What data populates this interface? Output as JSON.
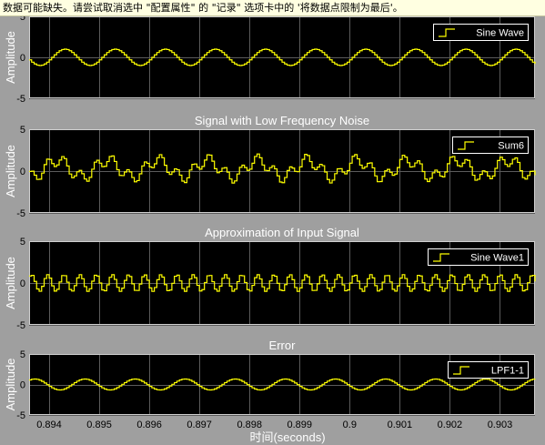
{
  "warning": {
    "text": "数据可能缺失。请尝试取消选中 \"配置属性\" 的 \"记录\" 选项卡中的 '将数据点限制为最后'。"
  },
  "colors": {
    "figure_bg": "#9f9f9f",
    "axes_bg": "#000000",
    "grid": "#5b5b5b",
    "signal": "#ffff00",
    "text": "#ffffff",
    "tick_text": "#000000",
    "warning_bg": "#ffffe1"
  },
  "chart_data": [
    {
      "type": "line",
      "title": "",
      "xlabel": "",
      "ylabel": "Amplitude",
      "xlim": [
        0.8936,
        0.9037
      ],
      "ylim": [
        -5,
        5
      ],
      "yticks": [
        -5,
        0,
        5
      ],
      "grid": true,
      "legend_position": "top-right",
      "series": [
        {
          "name": "Sine Wave",
          "signal": {
            "offset": 0,
            "components": [
              {
                "amplitude": 1.0,
                "frequency_hz": 1000,
                "phase_deg": -18
              }
            ]
          }
        }
      ]
    },
    {
      "type": "line",
      "title": "Signal with Low Frequency Noise",
      "xlabel": "",
      "ylabel": "Amplitude",
      "xlim": [
        0.8936,
        0.9037
      ],
      "ylim": [
        -5,
        5
      ],
      "yticks": [
        -5,
        0,
        5
      ],
      "grid": true,
      "legend_position": "top-right",
      "series": [
        {
          "name": "Sum6",
          "signal": {
            "offset": 0.3,
            "components": [
              {
                "amplitude": 1.0,
                "frequency_hz": 1000,
                "phase_deg": 40
              },
              {
                "amplitude": 0.75,
                "frequency_hz": 3100,
                "phase_deg": 0
              }
            ]
          }
        }
      ]
    },
    {
      "type": "line",
      "title": "Approximation of Input Signal",
      "xlabel": "",
      "ylabel": "Amplitude",
      "xlim": [
        0.8936,
        0.9037
      ],
      "ylim": [
        -5,
        5
      ],
      "yticks": [
        -5,
        0,
        5
      ],
      "grid": true,
      "legend_position": "top-right",
      "series": [
        {
          "name": "Sine Wave1",
          "signal": {
            "offset": 0,
            "components": [
              {
                "amplitude": 1.0,
                "frequency_hz": 3100,
                "phase_deg": 0
              }
            ]
          }
        }
      ]
    },
    {
      "type": "line",
      "title": "Error",
      "xlabel": "时间(seconds)",
      "ylabel": "Amplitude",
      "xlim": [
        0.8936,
        0.9037
      ],
      "ylim": [
        -5,
        5
      ],
      "yticks": [
        -5,
        0,
        5
      ],
      "xticks": [
        "0.894",
        "0.895",
        "0.896",
        "0.897",
        "0.898",
        "0.899",
        "0.9",
        "0.901",
        "0.902",
        "0.903"
      ],
      "grid": true,
      "legend_position": "top-right",
      "series": [
        {
          "name": "LPF1-1",
          "signal": {
            "offset": 0,
            "components": [
              {
                "amplitude": 0.9,
                "frequency_hz": 1000,
                "phase_deg": 200
              }
            ]
          }
        }
      ]
    }
  ]
}
